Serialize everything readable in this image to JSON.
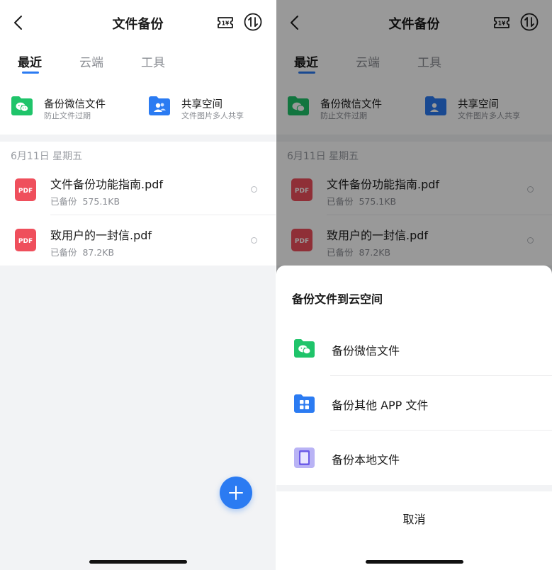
{
  "header": {
    "title": "文件备份"
  },
  "tabs": [
    {
      "label": "最近"
    },
    {
      "label": "云端"
    },
    {
      "label": "工具"
    }
  ],
  "quick_actions": [
    {
      "title": "备份微信文件",
      "subtitle": "防止文件过期",
      "icon": "wechat-folder-icon"
    },
    {
      "title": "共享空间",
      "subtitle": "文件图片多人共享",
      "icon": "shared-folder-icon"
    }
  ],
  "file_list": {
    "date": "6月11日 星期五",
    "files": [
      {
        "name": "文件备份功能指南.pdf",
        "status": "已备份",
        "size": "575.1KB"
      },
      {
        "name": "致用户的一封信.pdf",
        "status": "已备份",
        "size": "87.2KB"
      }
    ]
  },
  "icons": {
    "pdf_label": "PDF",
    "ticket_label": "1¥"
  },
  "sheet": {
    "title": "备份文件到云空间",
    "options": [
      {
        "label": "备份微信文件",
        "icon": "wechat-folder-icon"
      },
      {
        "label": "备份其他 APP 文件",
        "icon": "apps-folder-icon"
      },
      {
        "label": "备份本地文件",
        "icon": "phone-icon"
      }
    ],
    "cancel": "取消"
  },
  "colors": {
    "accent": "#2b7bf2",
    "wechat_green": "#1fc46a",
    "pdf_red": "#ef4f5c",
    "overlay": "rgba(0,0,0,0.40)"
  }
}
